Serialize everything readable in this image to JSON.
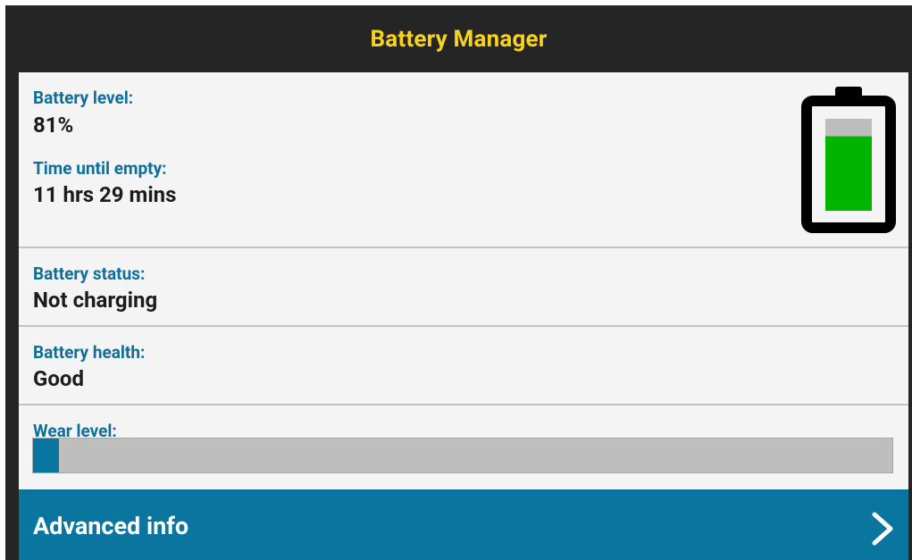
{
  "app": {
    "title": "Battery Manager"
  },
  "battery": {
    "level_label": "Battery level:",
    "level_value": "81%",
    "level_fraction": 0.81,
    "time_label": "Time until empty:",
    "time_value": "11 hrs 29 mins",
    "status_label": "Battery status:",
    "status_value": "Not charging",
    "health_label": "Battery health:",
    "health_value": "Good",
    "wear_label": "Wear level:",
    "wear_fraction": 0.03
  },
  "advanced": {
    "label": "Advanced info",
    "icon": "chevron-right-icon"
  },
  "colors": {
    "title": "#f7d31e",
    "accent": "#0a76a0",
    "battery_fill": "#00b400",
    "battery_empty": "#bdbdbd"
  }
}
